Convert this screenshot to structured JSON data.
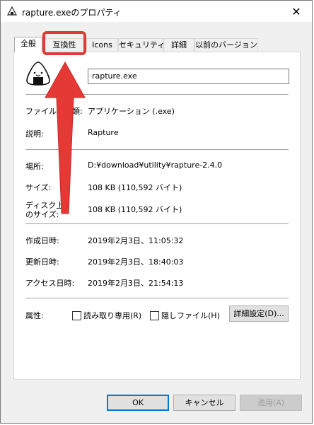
{
  "window": {
    "title": "rapture.exeのプロパティ",
    "close_glyph": "✕"
  },
  "tabs": [
    {
      "label": "全般",
      "active": true
    },
    {
      "label": "互換性",
      "active": false
    },
    {
      "label": "Icons",
      "active": false
    },
    {
      "label": "セキュリティ",
      "active": false
    },
    {
      "label": "詳細",
      "active": false
    },
    {
      "label": "以前のバージョン",
      "active": false
    }
  ],
  "general": {
    "file_name": "rapture.exe",
    "file_type_label": "ファイルの種類:",
    "file_type_value": "アプリケーション (.exe)",
    "description_label": "説明:",
    "description_value": "Rapture",
    "location_label": "場所:",
    "location_value": "D:¥download¥utility¥rapture-2.4.0",
    "size_label": "サイズ:",
    "size_value": "108 KB (110,592 バイト)",
    "disk_size_label_line1": "ディスク上",
    "disk_size_label_line2": "のサイズ:",
    "disk_size_value": "108 KB (110,592 バイト)",
    "created_label": "作成日時:",
    "created_value": "2019年2月3日、11:05:32",
    "modified_label": "更新日時:",
    "modified_value": "2019年2月3日、18:40:03",
    "accessed_label": "アクセス日時:",
    "accessed_value": "2019年2月3日、21:54:13",
    "attributes_label": "属性:",
    "readonly_label": "読み取り専用(R)",
    "hidden_label": "隠しファイル(H)",
    "advanced_button": "詳細設定(D)..."
  },
  "buttons": {
    "ok": "OK",
    "cancel": "キャンセル",
    "apply": "適用(A)"
  },
  "colors": {
    "annotation": "#e53935",
    "accent": "#0078d7"
  }
}
